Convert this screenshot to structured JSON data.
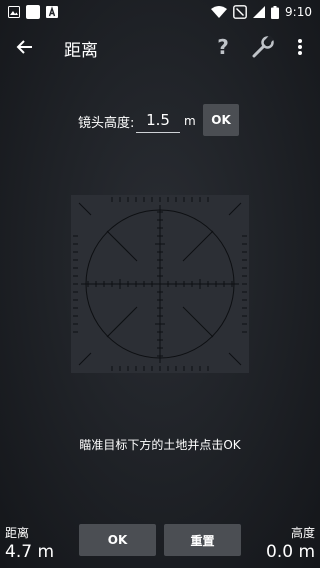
{
  "status_bar": {
    "time": "9:10",
    "left_icons": [
      "image-icon",
      "white-square-icon",
      "a-box-icon"
    ],
    "right_icons": [
      "wifi-icon",
      "battery-saver-icon",
      "signal-icon",
      "battery-icon"
    ]
  },
  "app_bar": {
    "title": "距离",
    "help_label": "?",
    "icons": [
      "back-arrow-icon",
      "help-icon",
      "wrench-icon",
      "more-vert-icon"
    ]
  },
  "lens": {
    "label": "镜头高度:",
    "value": "1.5",
    "unit": "m",
    "ok_label": "OK"
  },
  "instruction": "瞄准目标下方的土地并点击OK",
  "distance": {
    "label": "距离",
    "value": "4.7 m"
  },
  "height": {
    "label": "高度",
    "value": "0.0 m"
  },
  "buttons": {
    "ok_label": "OK",
    "reset_label": "重置"
  },
  "colors": {
    "background": "#202328",
    "button": "#4b4e53",
    "reticle_bg": "#2c2f35",
    "reticle_line": "#0d0f12"
  }
}
